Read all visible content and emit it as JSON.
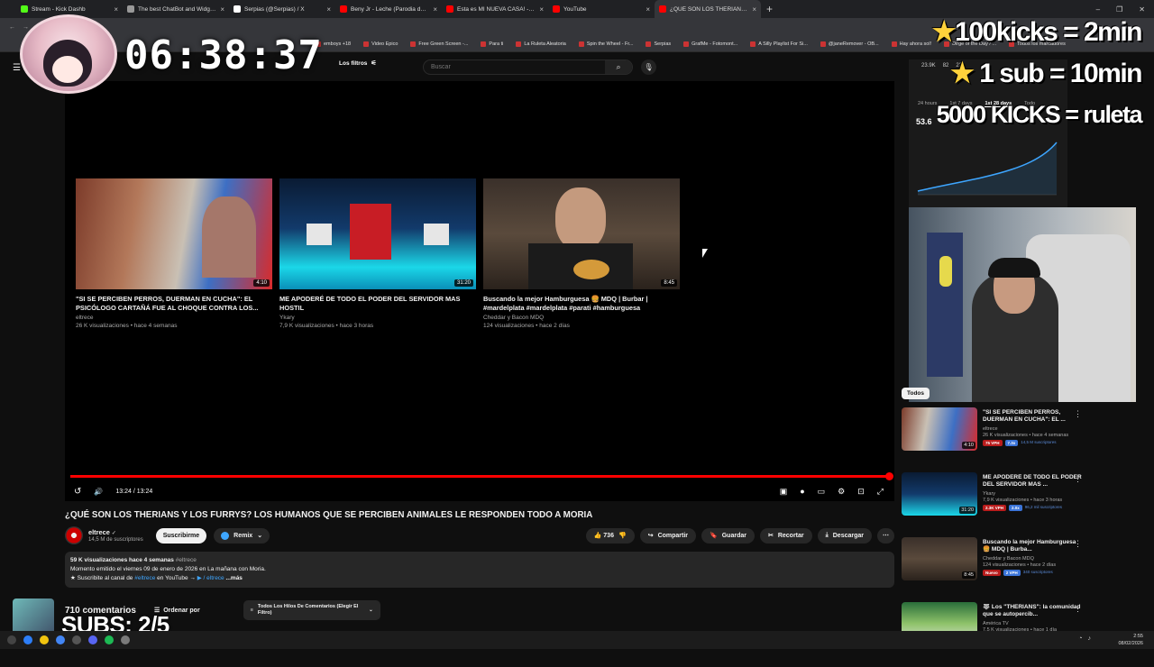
{
  "browser": {
    "tabs": [
      {
        "title": "Stream - Kick Dashb",
        "color": "#53fc18",
        "active": false
      },
      {
        "title": "The best ChatBot and Widgets",
        "color": "#999999",
        "active": false
      },
      {
        "title": "Serpias (@Serpias) / X",
        "color": "#ffffff",
        "active": false
      },
      {
        "title": "Beny Jr - Leche (Parodia de BO",
        "color": "#ff0000",
        "active": false
      },
      {
        "title": "Esta es MI NUEVA CASA! - Yo",
        "color": "#ff0000",
        "active": false
      },
      {
        "title": "YouTube",
        "color": "#ff0000",
        "active": false
      },
      {
        "title": "¿QUÉ SON LOS THERIANS Y LO",
        "color": "#ff0000",
        "active": true
      }
    ],
    "new_tab": "+",
    "window_controls": [
      "–",
      "❐",
      "✕"
    ],
    "bookmarks": [
      "emboys +18",
      "Video Epico",
      "Free Green Screen -...",
      "Para ti",
      "La Ruleta Aleatoria",
      "Spin the Wheel - Fr...",
      "Serpias",
      "GrafMe - Fotomont...",
      "A Silly Playlist For Si...",
      "@janeRemover - OB...",
      "Hay ahora sol!",
      "Dirge of the Day / ...",
      "Todos los marcadores"
    ]
  },
  "overlay": {
    "timer": "06:38:37",
    "rule1": "100kicks = 2min",
    "rule2": "1 sub = 10min",
    "rule3": "5000 KICKS = ruleta",
    "subs": "SUBS: 2/5",
    "star": "★"
  },
  "youtube": {
    "menu_icon": "☰",
    "filters_label": "Los filtros",
    "search_placeholder": "Buscar",
    "search_icon": "⌕",
    "mic_icon": "🎙"
  },
  "endcards": [
    {
      "title": "\"SI SE PERCIBEN PERROS, DUERMAN EN CUCHA\": EL PSICÓLOGO CARTAÑÁ FUE AL CHOQUE CONTRA LOS...",
      "channel": "eltrece",
      "meta": "26 K visualizaciones • hace 4 semanas",
      "duration": "4:10"
    },
    {
      "title": "ME APODERÉ DE TODO EL PODER DEL SERVIDOR MAS HOSTIL",
      "channel": "Ykary",
      "meta": "7,9 K visualizaciones • hace 3 horas",
      "duration": "31:20"
    },
    {
      "title": "Buscando la mejor Hamburguesa 🍔 MDQ | Burbar | #mardelplata #mardelplata #parati #hamburguesa",
      "channel": "Cheddar y Bacon MDQ",
      "meta": "124 visualizaciones • hace 2 días",
      "duration": "8:45"
    }
  ],
  "player": {
    "time": "13:24 / 13:24",
    "progress": 1.0,
    "replay_icon": "↺",
    "volume_icon": "🔊",
    "right_icons": [
      "▣",
      "●",
      "▭",
      "⚙",
      "⊡",
      "⤢"
    ]
  },
  "video": {
    "title": "¿QUÉ SON LOS THERIANS Y LOS FURRYS? LOS HUMANOS QUE SE PERCIBEN ANIMALES LE RESPONDEN TODO A MORIA",
    "channel": "eltrece",
    "verified": "✓",
    "subscribers": "14,5 M de suscriptores",
    "subscribe_label": "Suscribirme",
    "remix_label": "Remix",
    "likes": "736",
    "share_label": "Compartir",
    "save_label": "Guardar",
    "clip_label": "Recortar",
    "download_label": "Descargar",
    "more_icon": "⋯"
  },
  "description": {
    "stats": "59 K visualizaciones  hace 4 semanas",
    "hashtag": "#eltrece",
    "line2": "Momento emitido el viernes 09 de enero de 2026 en La mañana con Moria.",
    "line3_prefix": "★ Suscribite al canal de ",
    "line3_tag": "#eltrece",
    "line3_mid": " en YouTube → ",
    "line3_link": "▶ / eltrece",
    "more": "...más"
  },
  "comments": {
    "count": "710 comentarios",
    "sort_label": "Ordenar por",
    "thread_label": "Todos Los Hilos De Comentarios (Elegir El Filtro)"
  },
  "stats_panel": {
    "nums": [
      "23.9K",
      "82",
      "23"
    ],
    "ranges": [
      "24 hours",
      "1st 7 days",
      "1st 28 days",
      "Todo"
    ],
    "big": "53.6"
  },
  "sidebar": {
    "todos_label": "Todos",
    "recs": [
      {
        "title": "\"SI SE PERCIBEN PERROS, DUERMAN EN CUCHA\": EL ...",
        "channel": "eltrece",
        "meta": "26 K visualizaciones • hace 4 semanas",
        "duration": "4:10",
        "badges": [
          "75 VPH",
          "7.3x"
        ],
        "subs": "14,5 M suscriptores"
      },
      {
        "title": "ME APODERÉ DE TODO EL PODER DEL SERVIDOR MAS ...",
        "channel": "Ykary",
        "meta": "7,9 K visualizaciones • hace 3 horas",
        "duration": "31:20",
        "badges": [
          "2.3K VPH",
          "2.0x"
        ],
        "subs": "96,2 mil suscriptores"
      },
      {
        "title": "Buscando la mejor Hamburguesa 🍔 MDQ | Burba...",
        "channel": "Cheddar y Bacon MDQ",
        "meta": "124 visualizaciones • hace 2 días",
        "duration": "8:45",
        "badges": [
          "Nuevo",
          "2 VPH"
        ],
        "subs": "340 suscriptores"
      },
      {
        "title": "🐺 Los \"THERIANS\": la comunidad que se autopercib...",
        "channel": "América TV",
        "meta": "7,5 K visualizaciones • hace 1 día",
        "duration": "",
        "badges": [],
        "subs": ""
      }
    ]
  },
  "taskbar": {
    "time": "2:55",
    "date": "08/02/2026"
  }
}
